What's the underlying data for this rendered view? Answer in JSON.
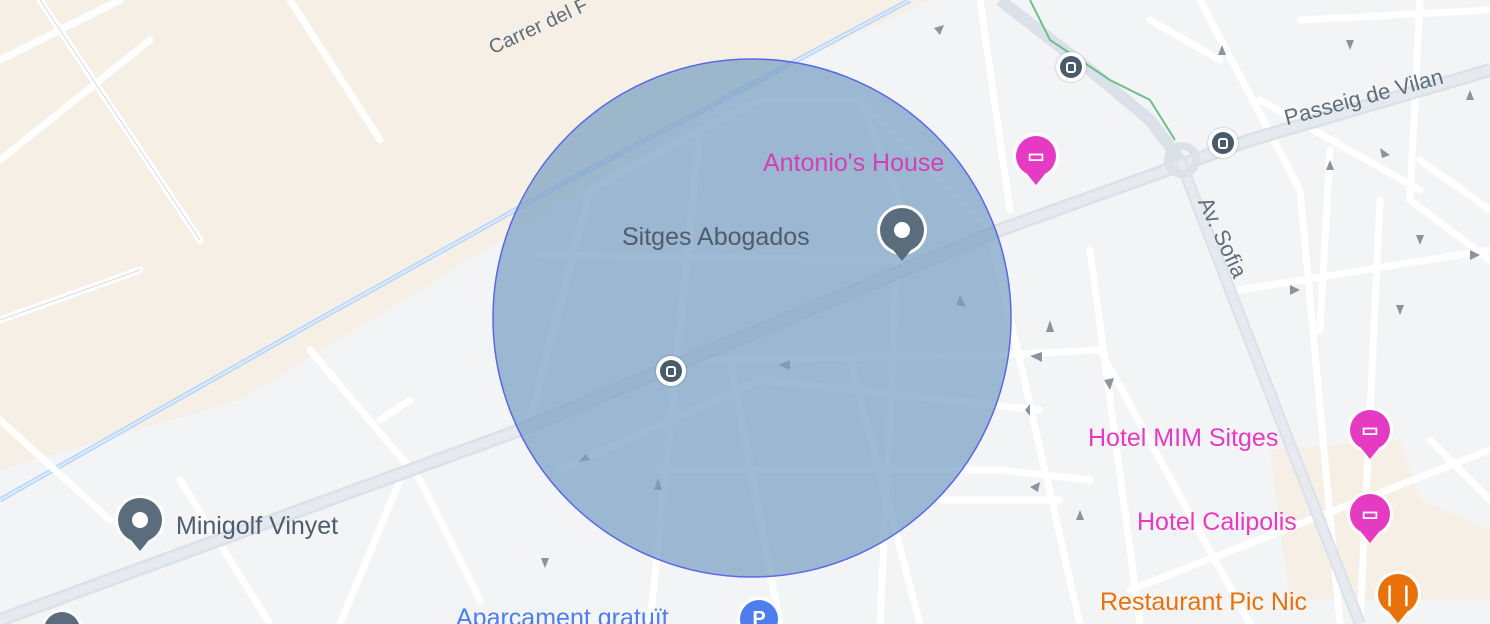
{
  "map": {
    "background_color": "#f3f4f6",
    "street_labels": [
      {
        "id": "carrer",
        "text": "Carrer del F"
      },
      {
        "id": "passeig",
        "text": "Passeig de Vilan"
      },
      {
        "id": "av-sofia",
        "text": "Av. Sofia"
      }
    ],
    "places": [
      {
        "id": "antonios-house",
        "name": "Antonio's House",
        "category": "hotel",
        "icon": "bed-icon",
        "color": "#e53bc2"
      },
      {
        "id": "sitges-abogados",
        "name": "Sitges Abogados",
        "category": "generic",
        "icon": "place-pin-icon",
        "color": "#5b6d7c"
      },
      {
        "id": "hotel-mim-sitges",
        "name": "Hotel MIM Sitges",
        "category": "hotel",
        "icon": "bed-icon",
        "color": "#e53bc2"
      },
      {
        "id": "hotel-calipolis",
        "name": "Hotel Calipolis",
        "category": "hotel",
        "icon": "bed-icon",
        "color": "#e53bc2"
      },
      {
        "id": "restaurant-pic-nic",
        "name": "Restaurant Pic Nic",
        "category": "restaurant",
        "icon": "fork-knife-icon",
        "color": "#e8710a"
      },
      {
        "id": "minigolf-vinyet",
        "name": "Minigolf Vinyet",
        "category": "generic",
        "icon": "place-pin-icon",
        "color": "#5b6d7c"
      },
      {
        "id": "aparcament",
        "name": "Aparcament gratuït",
        "category": "parking",
        "icon": "parking-icon",
        "color": "#4e7df0"
      }
    ],
    "parking_glyph": "P",
    "bus_stops": [
      "bus-stop-top",
      "bus-stop-passeig",
      "bus-stop-center"
    ],
    "radius_circle": {
      "fill": "#7a9fc2",
      "stroke": "#5a68e8"
    }
  }
}
